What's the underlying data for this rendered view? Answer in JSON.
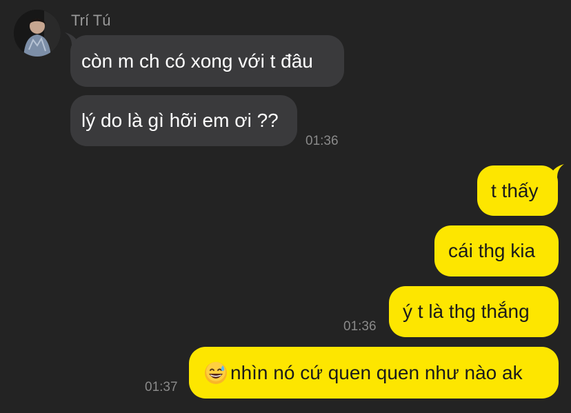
{
  "conversation": {
    "sender_name": "Trí Tú",
    "incoming": [
      {
        "text": "còn m ch có xong với t đâu"
      },
      {
        "text": "lý do là gì hỡi em ơi ??"
      }
    ],
    "incoming_time": "01:36",
    "outgoing": [
      {
        "text": "t thấy"
      },
      {
        "text": "cái thg kia"
      },
      {
        "text": "ý t là thg thắng"
      },
      {
        "text": "nhìn nó cứ quen quen như nào ak",
        "emoji": "sweat-smile-emoji"
      }
    ],
    "outgoing_time_1": "01:36",
    "outgoing_time_2": "01:37"
  },
  "colors": {
    "background": "#232323",
    "incoming_bubble": "#3a3a3c",
    "outgoing_bubble": "#fde600",
    "timestamp": "#8a8a8a",
    "sender": "#9a9a9a"
  }
}
